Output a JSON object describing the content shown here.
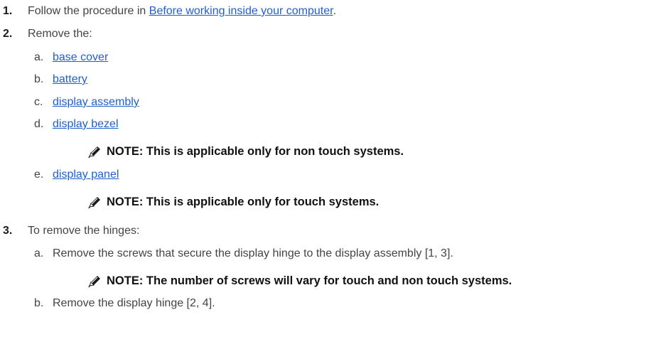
{
  "steps": [
    {
      "number": "1.",
      "prefix": "Follow the procedure in ",
      "link": "Before working inside your computer",
      "suffix": "."
    },
    {
      "number": "2.",
      "text": "Remove the:",
      "items": [
        {
          "letter": "a.",
          "link": "base cover"
        },
        {
          "letter": "b.",
          "link": "battery"
        },
        {
          "letter": "c.",
          "link": "display assembly"
        },
        {
          "letter": "d.",
          "link": "display bezel",
          "note": "NOTE: This is applicable only for non touch systems."
        },
        {
          "letter": "e.",
          "link": "display panel",
          "note": "NOTE: This is applicable only for touch systems."
        }
      ]
    },
    {
      "number": "3.",
      "text": "To remove the hinges:",
      "items": [
        {
          "letter": "a.",
          "text": "Remove the screws that secure the display hinge to the display assembly [1, 3].",
          "note": "NOTE: The number of screws will vary for touch and non touch systems."
        },
        {
          "letter": "b.",
          "text": "Remove the display hinge [2, 4]."
        }
      ]
    }
  ],
  "icons": {
    "note": "note-pencil-icon"
  }
}
